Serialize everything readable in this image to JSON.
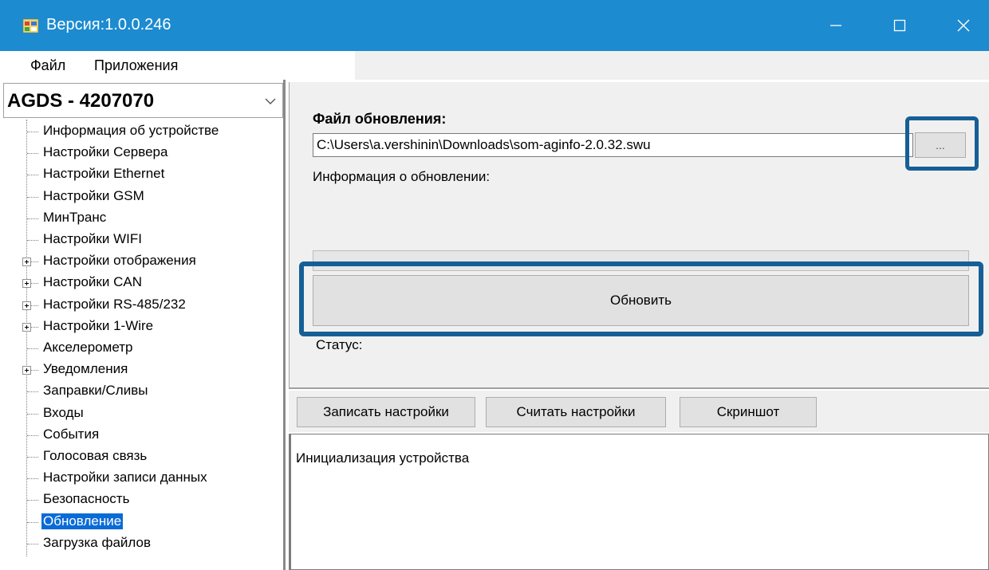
{
  "window": {
    "title": "Версия:1.0.0.246",
    "minimize_icon": "minimize-icon",
    "maximize_icon": "maximize-icon",
    "close_icon": "close-icon"
  },
  "menu": {
    "items": [
      {
        "label": "Файл"
      },
      {
        "label": "Приложения"
      }
    ]
  },
  "sidebar": {
    "device": "AGDS - 4207070",
    "tree": [
      {
        "label": "Информация об устройстве",
        "expandable": false
      },
      {
        "label": "Настройки Сервера",
        "expandable": false
      },
      {
        "label": "Настройки Ethernet",
        "expandable": false
      },
      {
        "label": "Настройки GSM",
        "expandable": false
      },
      {
        "label": "МинТранс",
        "expandable": false
      },
      {
        "label": "Настройки WIFI",
        "expandable": false
      },
      {
        "label": "Настройки отображения",
        "expandable": true
      },
      {
        "label": "Настройки CAN",
        "expandable": true
      },
      {
        "label": "Настройки RS-485/232",
        "expandable": true
      },
      {
        "label": "Настройки 1-Wire",
        "expandable": true
      },
      {
        "label": "Акселерометр",
        "expandable": false
      },
      {
        "label": "Уведомления",
        "expandable": true
      },
      {
        "label": "Заправки/Сливы",
        "expandable": false
      },
      {
        "label": "Входы",
        "expandable": false
      },
      {
        "label": "События",
        "expandable": false
      },
      {
        "label": "Голосовая связь",
        "expandable": false
      },
      {
        "label": "Настройки записи данных",
        "expandable": false
      },
      {
        "label": "Безопасность",
        "expandable": false
      },
      {
        "label": "Обновление",
        "expandable": false,
        "selected": true
      },
      {
        "label": "Загрузка файлов",
        "expandable": false
      }
    ]
  },
  "update": {
    "file_label": "Файл обновления:",
    "file_path": "C:\\Users\\a.vershinin\\Downloads\\som-aginfo-2.0.32.swu",
    "browse_label": "...",
    "info_label": "Информация о обновлении:",
    "update_button": "Обновить",
    "status_label": "Статус:",
    "progress": 0
  },
  "toolbar": {
    "write_settings": "Записать настройки",
    "read_settings": "Считать настройки",
    "screenshot": "Скриншот"
  },
  "log": {
    "text": "Инициализация устройства"
  },
  "colors": {
    "titlebar": "#1c8bd0",
    "highlight": "#165f96",
    "selection": "#0a6bd6"
  }
}
